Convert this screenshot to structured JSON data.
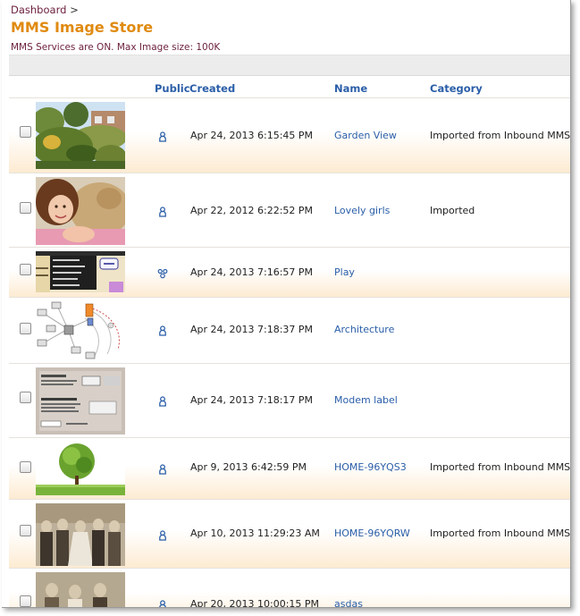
{
  "breadcrumb": {
    "link": "Dashboard",
    "separator": ">"
  },
  "page_title": "MMS Image Store",
  "status": {
    "text": "MMS Services are ON. Max Image size:",
    "max_size": "100K"
  },
  "columns": {
    "public": "Public",
    "created": "Created",
    "name": "Name",
    "category": "Category"
  },
  "icons": {
    "public_single": "person-icon",
    "public_group": "group-icon",
    "checkbox": "checkbox"
  },
  "colors": {
    "title": "#e08a10",
    "link": "#2a5ea8",
    "status": "#6b1e3c",
    "row_tint": "#fdebd2"
  },
  "rows": [
    {
      "thumb_icon": "garden-thumbnail",
      "public_icon": "person-icon",
      "created": "Apr 24, 2013 6:15:45 PM",
      "name": "Garden View",
      "category": "Imported from Inbound MMS"
    },
    {
      "thumb_icon": "girl-dog-thumbnail",
      "public_icon": "person-icon",
      "created": "Apr 22, 2012 6:22:52 PM",
      "name": "Lovely girls",
      "category": "Imported"
    },
    {
      "thumb_icon": "slide-thumbnail",
      "public_icon": "group-icon",
      "created": "Apr 24, 2013 7:16:57 PM",
      "name": "Play",
      "category": ""
    },
    {
      "thumb_icon": "network-diagram-thumbnail",
      "public_icon": "person-icon",
      "created": "Apr 24, 2013 7:18:37 PM",
      "name": "Architecture",
      "category": ""
    },
    {
      "thumb_icon": "modem-label-thumbnail",
      "public_icon": "person-icon",
      "created": "Apr 24, 2013 7:18:17 PM",
      "name": "Modem label",
      "category": ""
    },
    {
      "thumb_icon": "tree-head-thumbnail",
      "public_icon": "person-icon",
      "created": "Apr 9, 2013 6:42:59 PM",
      "name": "HOME-96YQS3",
      "category": "Imported from Inbound MMS"
    },
    {
      "thumb_icon": "wedding-photo-thumbnail",
      "public_icon": "person-icon",
      "created": "Apr 10, 2013 11:29:23 AM",
      "name": "HOME-96YQRW",
      "category": "Imported from Inbound MMS"
    },
    {
      "thumb_icon": "old-photo-thumbnail",
      "public_icon": "person-icon",
      "created": "Apr 20, 2013 10:00:15 PM",
      "name": "asdas",
      "category": ""
    }
  ]
}
